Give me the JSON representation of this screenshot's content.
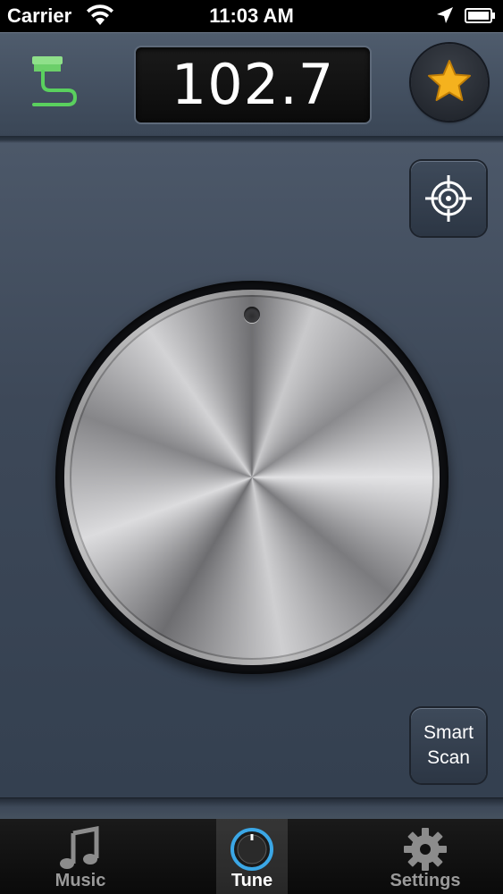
{
  "status_bar": {
    "carrier": "Carrier",
    "time": "11:03 AM",
    "wifi_icon": "wifi-icon",
    "location_icon": "location-arrow-icon",
    "battery_icon": "battery-icon"
  },
  "header": {
    "frequency": "102.7",
    "router_icon": "router-connection-icon",
    "favorite_icon": "star-icon",
    "favorite_color": "#f5b21e"
  },
  "main": {
    "target_icon": "crosshair-icon",
    "knob_icon": "tuning-knob",
    "smart_scan_line1": "Smart",
    "smart_scan_line2": "Scan"
  },
  "tab_bar": {
    "tabs": [
      {
        "label": "Music",
        "icon": "music-note-icon",
        "selected": false
      },
      {
        "label": "Tune",
        "icon": "tune-knob-icon",
        "selected": true
      },
      {
        "label": "Settings",
        "icon": "gear-icon",
        "selected": false
      }
    ],
    "accent_color": "#3ba7e6"
  }
}
